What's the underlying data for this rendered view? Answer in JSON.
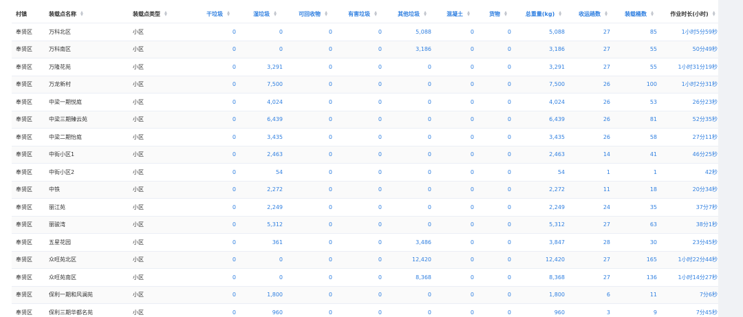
{
  "columns": [
    {
      "key": "town",
      "label": "村镇",
      "align": "left",
      "sortable": false
    },
    {
      "key": "name",
      "label": "装载点名称",
      "align": "left",
      "sortable": true
    },
    {
      "key": "type",
      "label": "装载点类型",
      "align": "left",
      "sortable": true
    },
    {
      "key": "dry",
      "label": "干垃圾",
      "align": "num",
      "sortable": true
    },
    {
      "key": "wet",
      "label": "湿垃圾",
      "align": "num",
      "sortable": true
    },
    {
      "key": "recyclable",
      "label": "可回收物",
      "align": "num",
      "sortable": true
    },
    {
      "key": "hazardous",
      "label": "有害垃圾",
      "align": "num",
      "sortable": true
    },
    {
      "key": "other",
      "label": "其他垃圾",
      "align": "num",
      "sortable": true
    },
    {
      "key": "concrete",
      "label": "混凝土",
      "align": "num",
      "sortable": true
    },
    {
      "key": "goods",
      "label": "货物",
      "align": "num",
      "sortable": true
    },
    {
      "key": "total",
      "label": "总重量(kg)",
      "align": "num",
      "sortable": true
    },
    {
      "key": "trips",
      "label": "收运趟数",
      "align": "num",
      "sortable": true
    },
    {
      "key": "bins",
      "label": "装载桶数",
      "align": "num",
      "sortable": true
    },
    {
      "key": "duration",
      "label": "作业时长(小时)",
      "align": "num",
      "sortable": true
    }
  ],
  "rows": [
    {
      "town": "奉贤区",
      "name": "万科北区",
      "type": "小区",
      "dry": "0",
      "wet": "0",
      "recyclable": "0",
      "hazardous": "0",
      "other": "5,088",
      "concrete": "0",
      "goods": "0",
      "total": "5,088",
      "trips": "27",
      "bins": "85",
      "duration": "1小时5分59秒"
    },
    {
      "town": "奉贤区",
      "name": "万科南区",
      "type": "小区",
      "dry": "0",
      "wet": "0",
      "recyclable": "0",
      "hazardous": "0",
      "other": "3,186",
      "concrete": "0",
      "goods": "0",
      "total": "3,186",
      "trips": "27",
      "bins": "55",
      "duration": "50分49秒"
    },
    {
      "town": "奉贤区",
      "name": "万隆花苑",
      "type": "小区",
      "dry": "0",
      "wet": "3,291",
      "recyclable": "0",
      "hazardous": "0",
      "other": "0",
      "concrete": "0",
      "goods": "0",
      "total": "3,291",
      "trips": "27",
      "bins": "55",
      "duration": "1小时31分19秒"
    },
    {
      "town": "奉贤区",
      "name": "万龙新村",
      "type": "小区",
      "dry": "0",
      "wet": "7,500",
      "recyclable": "0",
      "hazardous": "0",
      "other": "0",
      "concrete": "0",
      "goods": "0",
      "total": "7,500",
      "trips": "26",
      "bins": "100",
      "duration": "1小时2分31秒"
    },
    {
      "town": "奉贤区",
      "name": "中梁一期悦庭",
      "type": "小区",
      "dry": "0",
      "wet": "4,024",
      "recyclable": "0",
      "hazardous": "0",
      "other": "0",
      "concrete": "0",
      "goods": "0",
      "total": "4,024",
      "trips": "26",
      "bins": "53",
      "duration": "26分23秒"
    },
    {
      "town": "奉贤区",
      "name": "中梁三期臻云苑",
      "type": "小区",
      "dry": "0",
      "wet": "6,439",
      "recyclable": "0",
      "hazardous": "0",
      "other": "0",
      "concrete": "0",
      "goods": "0",
      "total": "6,439",
      "trips": "26",
      "bins": "81",
      "duration": "52分35秒"
    },
    {
      "town": "奉贤区",
      "name": "中梁二期怡庭",
      "type": "小区",
      "dry": "0",
      "wet": "3,435",
      "recyclable": "0",
      "hazardous": "0",
      "other": "0",
      "concrete": "0",
      "goods": "0",
      "total": "3,435",
      "trips": "26",
      "bins": "58",
      "duration": "27分11秒"
    },
    {
      "town": "奉贤区",
      "name": "中街小区1",
      "type": "小区",
      "dry": "0",
      "wet": "2,463",
      "recyclable": "0",
      "hazardous": "0",
      "other": "0",
      "concrete": "0",
      "goods": "0",
      "total": "2,463",
      "trips": "14",
      "bins": "41",
      "duration": "46分25秒"
    },
    {
      "town": "奉贤区",
      "name": "中街小区2",
      "type": "小区",
      "dry": "0",
      "wet": "54",
      "recyclable": "0",
      "hazardous": "0",
      "other": "0",
      "concrete": "0",
      "goods": "0",
      "total": "54",
      "trips": "1",
      "bins": "1",
      "duration": "42秒"
    },
    {
      "town": "奉贤区",
      "name": "中铁",
      "type": "小区",
      "dry": "0",
      "wet": "2,272",
      "recyclable": "0",
      "hazardous": "0",
      "other": "0",
      "concrete": "0",
      "goods": "0",
      "total": "2,272",
      "trips": "11",
      "bins": "18",
      "duration": "20分34秒"
    },
    {
      "town": "奉贤区",
      "name": "丽江苑",
      "type": "小区",
      "dry": "0",
      "wet": "2,249",
      "recyclable": "0",
      "hazardous": "0",
      "other": "0",
      "concrete": "0",
      "goods": "0",
      "total": "2,249",
      "trips": "24",
      "bins": "35",
      "duration": "37分7秒"
    },
    {
      "town": "奉贤区",
      "name": "丽骏湾",
      "type": "小区",
      "dry": "0",
      "wet": "5,312",
      "recyclable": "0",
      "hazardous": "0",
      "other": "0",
      "concrete": "0",
      "goods": "0",
      "total": "5,312",
      "trips": "27",
      "bins": "63",
      "duration": "38分1秒"
    },
    {
      "town": "奉贤区",
      "name": "五星花园",
      "type": "小区",
      "dry": "0",
      "wet": "361",
      "recyclable": "0",
      "hazardous": "0",
      "other": "3,486",
      "concrete": "0",
      "goods": "0",
      "total": "3,847",
      "trips": "28",
      "bins": "30",
      "duration": "23分45秒"
    },
    {
      "town": "奉贤区",
      "name": "众旺苑北区",
      "type": "小区",
      "dry": "0",
      "wet": "0",
      "recyclable": "0",
      "hazardous": "0",
      "other": "12,420",
      "concrete": "0",
      "goods": "0",
      "total": "12,420",
      "trips": "27",
      "bins": "165",
      "duration": "1小时22分44秒"
    },
    {
      "town": "奉贤区",
      "name": "众旺苑南区",
      "type": "小区",
      "dry": "0",
      "wet": "0",
      "recyclable": "0",
      "hazardous": "0",
      "other": "8,368",
      "concrete": "0",
      "goods": "0",
      "total": "8,368",
      "trips": "27",
      "bins": "136",
      "duration": "1小时14分27秒"
    },
    {
      "town": "奉贤区",
      "name": "保利一期和风澜苑",
      "type": "小区",
      "dry": "0",
      "wet": "1,800",
      "recyclable": "0",
      "hazardous": "0",
      "other": "0",
      "concrete": "0",
      "goods": "0",
      "total": "1,800",
      "trips": "6",
      "bins": "11",
      "duration": "7分6秒"
    },
    {
      "town": "奉贤区",
      "name": "保利三期华都名苑",
      "type": "小区",
      "dry": "0",
      "wet": "960",
      "recyclable": "0",
      "hazardous": "0",
      "other": "0",
      "concrete": "0",
      "goods": "0",
      "total": "960",
      "trips": "3",
      "bins": "9",
      "duration": "7分45秒"
    }
  ]
}
